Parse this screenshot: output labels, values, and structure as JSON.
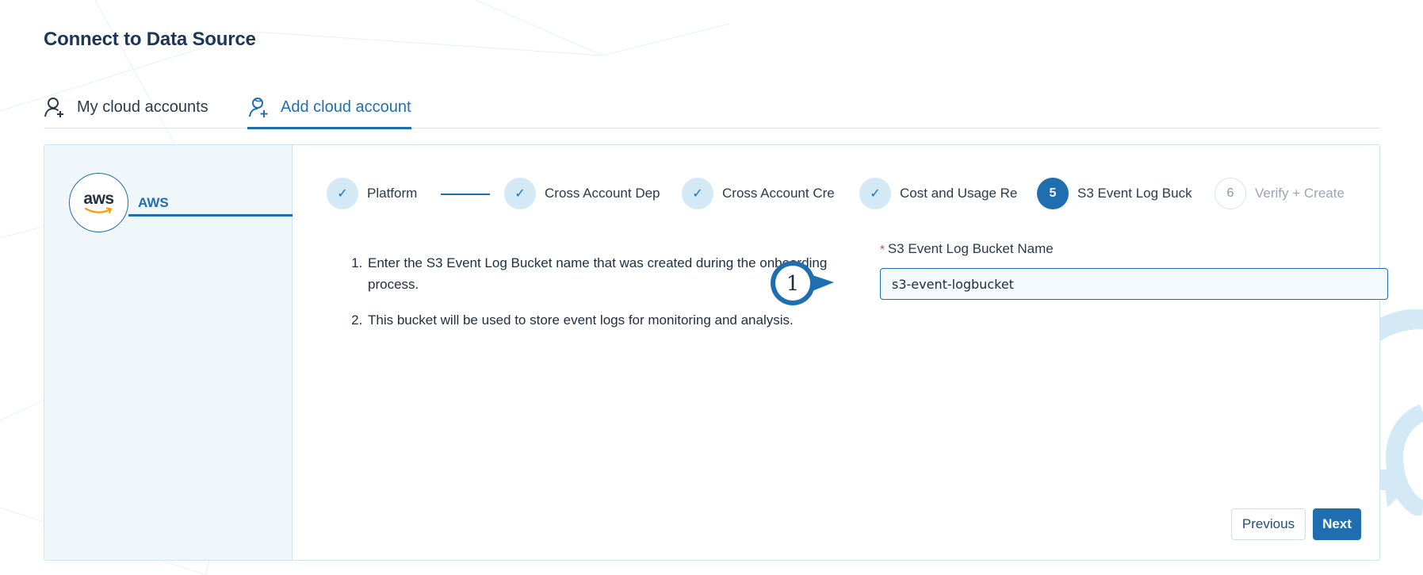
{
  "page": {
    "title": "Connect to Data Source"
  },
  "tabs": [
    {
      "label": "My cloud accounts",
      "icon": "user-icon",
      "active": false
    },
    {
      "label": "Add cloud account",
      "icon": "add-user-icon",
      "active": true
    }
  ],
  "sidebar": {
    "provider": {
      "logo_text": "aws",
      "label": "AWS",
      "icon": "aws-logo-icon"
    }
  },
  "stepper": {
    "steps": [
      {
        "marker": "✓",
        "label": "Platform",
        "state": "done"
      },
      {
        "marker": "✓",
        "label": "Cross Account Dep",
        "state": "done"
      },
      {
        "marker": "✓",
        "label": "Cross Account Cre",
        "state": "done"
      },
      {
        "marker": "✓",
        "label": "Cost and Usage Re",
        "state": "done"
      },
      {
        "marker": "5",
        "label": "S3 Event Log Buck",
        "state": "active"
      },
      {
        "marker": "6",
        "label": "Verify + Create",
        "state": "pending"
      }
    ]
  },
  "instructions": {
    "items": [
      "Enter the S3 Event Log Bucket name that was created during the onboarding process.",
      "This bucket will be used to store event logs for monitoring and analysis."
    ]
  },
  "form": {
    "bucket_name": {
      "label": "S3 Event Log Bucket Name",
      "required_mark": "*",
      "value": "s3-event-logbucket"
    }
  },
  "annotation": {
    "marker_number": "1"
  },
  "actions": {
    "previous_label": "Previous",
    "next_label": "Next"
  },
  "colors": {
    "accent": "#1f6fb0",
    "title": "#1d3557",
    "step_done_bg": "#d3eaf6",
    "required": "#e0443a",
    "sidebar_bg": "#f0f7fb"
  }
}
